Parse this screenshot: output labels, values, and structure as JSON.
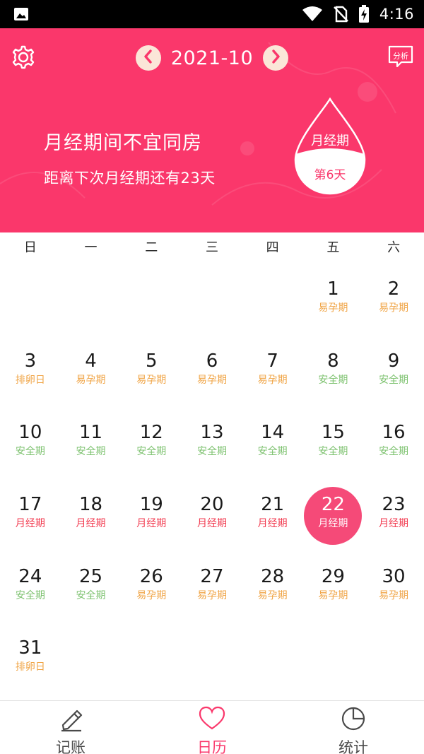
{
  "status_bar": {
    "time": "4:16",
    "icons": [
      "image-icon",
      "wifi-icon",
      "no-sim-icon",
      "battery-charging-icon"
    ]
  },
  "header": {
    "month": "2021-10",
    "analysis_label": "分析",
    "warning": "月经期间不宜同房",
    "next_period": "距离下次月经期还有23天",
    "phase_badge": {
      "title": "月经期",
      "day": "第6天"
    },
    "colors": {
      "background": "#fa376b",
      "nav_circle": "#fbe6d8"
    }
  },
  "calendar": {
    "weekdays": [
      "日",
      "一",
      "二",
      "三",
      "四",
      "五",
      "六"
    ],
    "leading_blanks": 5,
    "today": 22,
    "days": [
      {
        "day": "1",
        "label": "易孕期",
        "type": "fertile"
      },
      {
        "day": "2",
        "label": "易孕期",
        "type": "fertile"
      },
      {
        "day": "3",
        "label": "排卵日",
        "type": "fertile"
      },
      {
        "day": "4",
        "label": "易孕期",
        "type": "fertile"
      },
      {
        "day": "5",
        "label": "易孕期",
        "type": "fertile"
      },
      {
        "day": "6",
        "label": "易孕期",
        "type": "fertile"
      },
      {
        "day": "7",
        "label": "易孕期",
        "type": "fertile"
      },
      {
        "day": "8",
        "label": "安全期",
        "type": "safe"
      },
      {
        "day": "9",
        "label": "安全期",
        "type": "safe"
      },
      {
        "day": "10",
        "label": "安全期",
        "type": "safe"
      },
      {
        "day": "11",
        "label": "安全期",
        "type": "safe"
      },
      {
        "day": "12",
        "label": "安全期",
        "type": "safe"
      },
      {
        "day": "13",
        "label": "安全期",
        "type": "safe"
      },
      {
        "day": "14",
        "label": "安全期",
        "type": "safe"
      },
      {
        "day": "15",
        "label": "安全期",
        "type": "safe"
      },
      {
        "day": "16",
        "label": "安全期",
        "type": "safe"
      },
      {
        "day": "17",
        "label": "月经期",
        "type": "period"
      },
      {
        "day": "18",
        "label": "月经期",
        "type": "period"
      },
      {
        "day": "19",
        "label": "月经期",
        "type": "period"
      },
      {
        "day": "20",
        "label": "月经期",
        "type": "period"
      },
      {
        "day": "21",
        "label": "月经期",
        "type": "period"
      },
      {
        "day": "22",
        "label": "月经期",
        "type": "period"
      },
      {
        "day": "23",
        "label": "月经期",
        "type": "period"
      },
      {
        "day": "24",
        "label": "安全期",
        "type": "safe"
      },
      {
        "day": "25",
        "label": "安全期",
        "type": "safe"
      },
      {
        "day": "26",
        "label": "易孕期",
        "type": "fertile"
      },
      {
        "day": "27",
        "label": "易孕期",
        "type": "fertile"
      },
      {
        "day": "28",
        "label": "易孕期",
        "type": "fertile"
      },
      {
        "day": "29",
        "label": "易孕期",
        "type": "fertile"
      },
      {
        "day": "30",
        "label": "易孕期",
        "type": "fertile"
      },
      {
        "day": "31",
        "label": "排卵日",
        "type": "fertile"
      }
    ],
    "colors": {
      "safe": "#7dc26f",
      "fertile": "#f0a445",
      "period": "#f23a4f",
      "today": "#f54a78"
    }
  },
  "bottom_nav": {
    "items": [
      {
        "label": "记账",
        "icon": "pencil-icon",
        "active": false
      },
      {
        "label": "日历",
        "icon": "heart-icon",
        "active": true
      },
      {
        "label": "统计",
        "icon": "pie-chart-icon",
        "active": false
      }
    ]
  }
}
